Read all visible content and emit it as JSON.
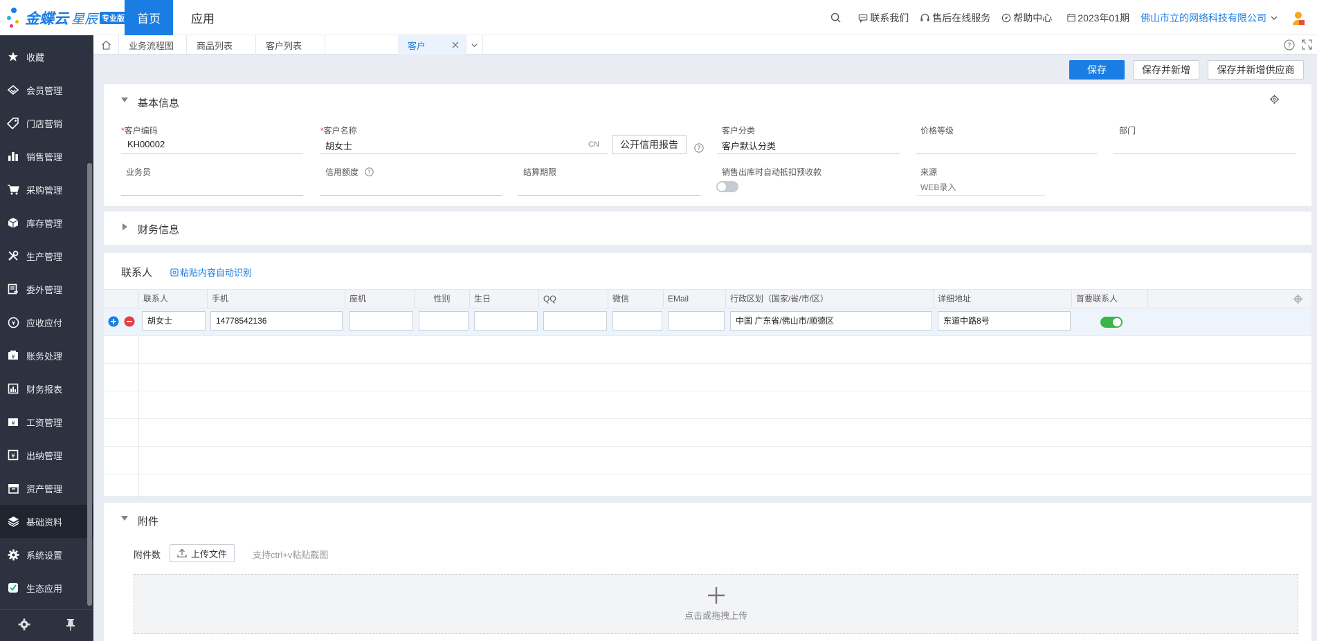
{
  "brand": {
    "name": "金蝶云",
    "product": "星辰",
    "badge": "专业版"
  },
  "topnav": {
    "home": "首页",
    "apps": "应用"
  },
  "header": {
    "contact": "联系我们",
    "service": "售后在线服务",
    "help": "帮助中心",
    "period": "2023年01期",
    "company": "佛山市立的网络科技有限公司"
  },
  "sidebar": {
    "items": [
      {
        "label": "收藏",
        "icon": "star-icon"
      },
      {
        "label": "会员管理",
        "icon": "diamond-icon"
      },
      {
        "label": "门店营销",
        "icon": "tag-icon"
      },
      {
        "label": "销售管理",
        "icon": "bar-chart-icon"
      },
      {
        "label": "采购管理",
        "icon": "cart-icon"
      },
      {
        "label": "库存管理",
        "icon": "box-icon"
      },
      {
        "label": "生产管理",
        "icon": "tools-icon"
      },
      {
        "label": "委外管理",
        "icon": "outsource-icon"
      },
      {
        "label": "应收应付",
        "icon": "coin-icon"
      },
      {
        "label": "账务处理",
        "icon": "ledger-icon"
      },
      {
        "label": "财务报表",
        "icon": "report-icon"
      },
      {
        "label": "工资管理",
        "icon": "salary-icon"
      },
      {
        "label": "出纳管理",
        "icon": "cashier-icon"
      },
      {
        "label": "资产管理",
        "icon": "asset-icon"
      },
      {
        "label": "基础资料",
        "icon": "layers-icon"
      },
      {
        "label": "系统设置",
        "icon": "gear-icon"
      },
      {
        "label": "生态应用",
        "icon": "eco-icon"
      }
    ],
    "active": "基础资料"
  },
  "tabs": [
    {
      "label": "业务流程图"
    },
    {
      "label": "商品列表"
    },
    {
      "label": "客户列表"
    },
    {
      "label": "客户"
    }
  ],
  "toolbar": {
    "save": "保存",
    "save_new": "保存并新增",
    "save_new_supplier": "保存并新增供应商"
  },
  "basic": {
    "title": "基本信息",
    "code_label": "客户编码",
    "code_value": "KH00002",
    "name_label": "客户名称",
    "name_value": "胡女士",
    "name_lang": "CN",
    "credit_report": "公开信用报告",
    "category_label": "客户分类",
    "category_value": "客户默认分类",
    "price_label": "价格等级",
    "dept_label": "部门",
    "salesman_label": "业务员",
    "credit_label": "信用额度",
    "settle_label": "结算期限",
    "auto_offset_label": "销售出库时自动抵扣预收款",
    "source_label": "来源",
    "source_value": "WEB录入"
  },
  "finance": {
    "title": "财务信息"
  },
  "contacts": {
    "title": "联系人",
    "paste_link": "粘贴内容自动识别",
    "columns": [
      "联系人",
      "手机",
      "座机",
      "性别",
      "生日",
      "QQ",
      "微信",
      "EMail",
      "行政区划（国家/省/市/区）",
      "详细地址",
      "首要联系人"
    ],
    "row": {
      "name": "胡女士",
      "mobile": "14778542136",
      "phone": "",
      "gender": "",
      "birthday": "",
      "qq": "",
      "wechat": "",
      "email": "",
      "region": "中国 广东省/佛山市/顺德区",
      "address": "东道中路8号",
      "primary": true
    }
  },
  "attachments": {
    "title": "附件",
    "count_label": "附件数",
    "upload": "上传文件",
    "hint": "支持ctrl+v粘贴截图",
    "drop_text": "点击或拖拽上传"
  },
  "colors": {
    "accent": "#1a7de3",
    "sidebar": "#2c3240",
    "toggle_on": "#3ab54a",
    "danger": "#e23f3f"
  }
}
